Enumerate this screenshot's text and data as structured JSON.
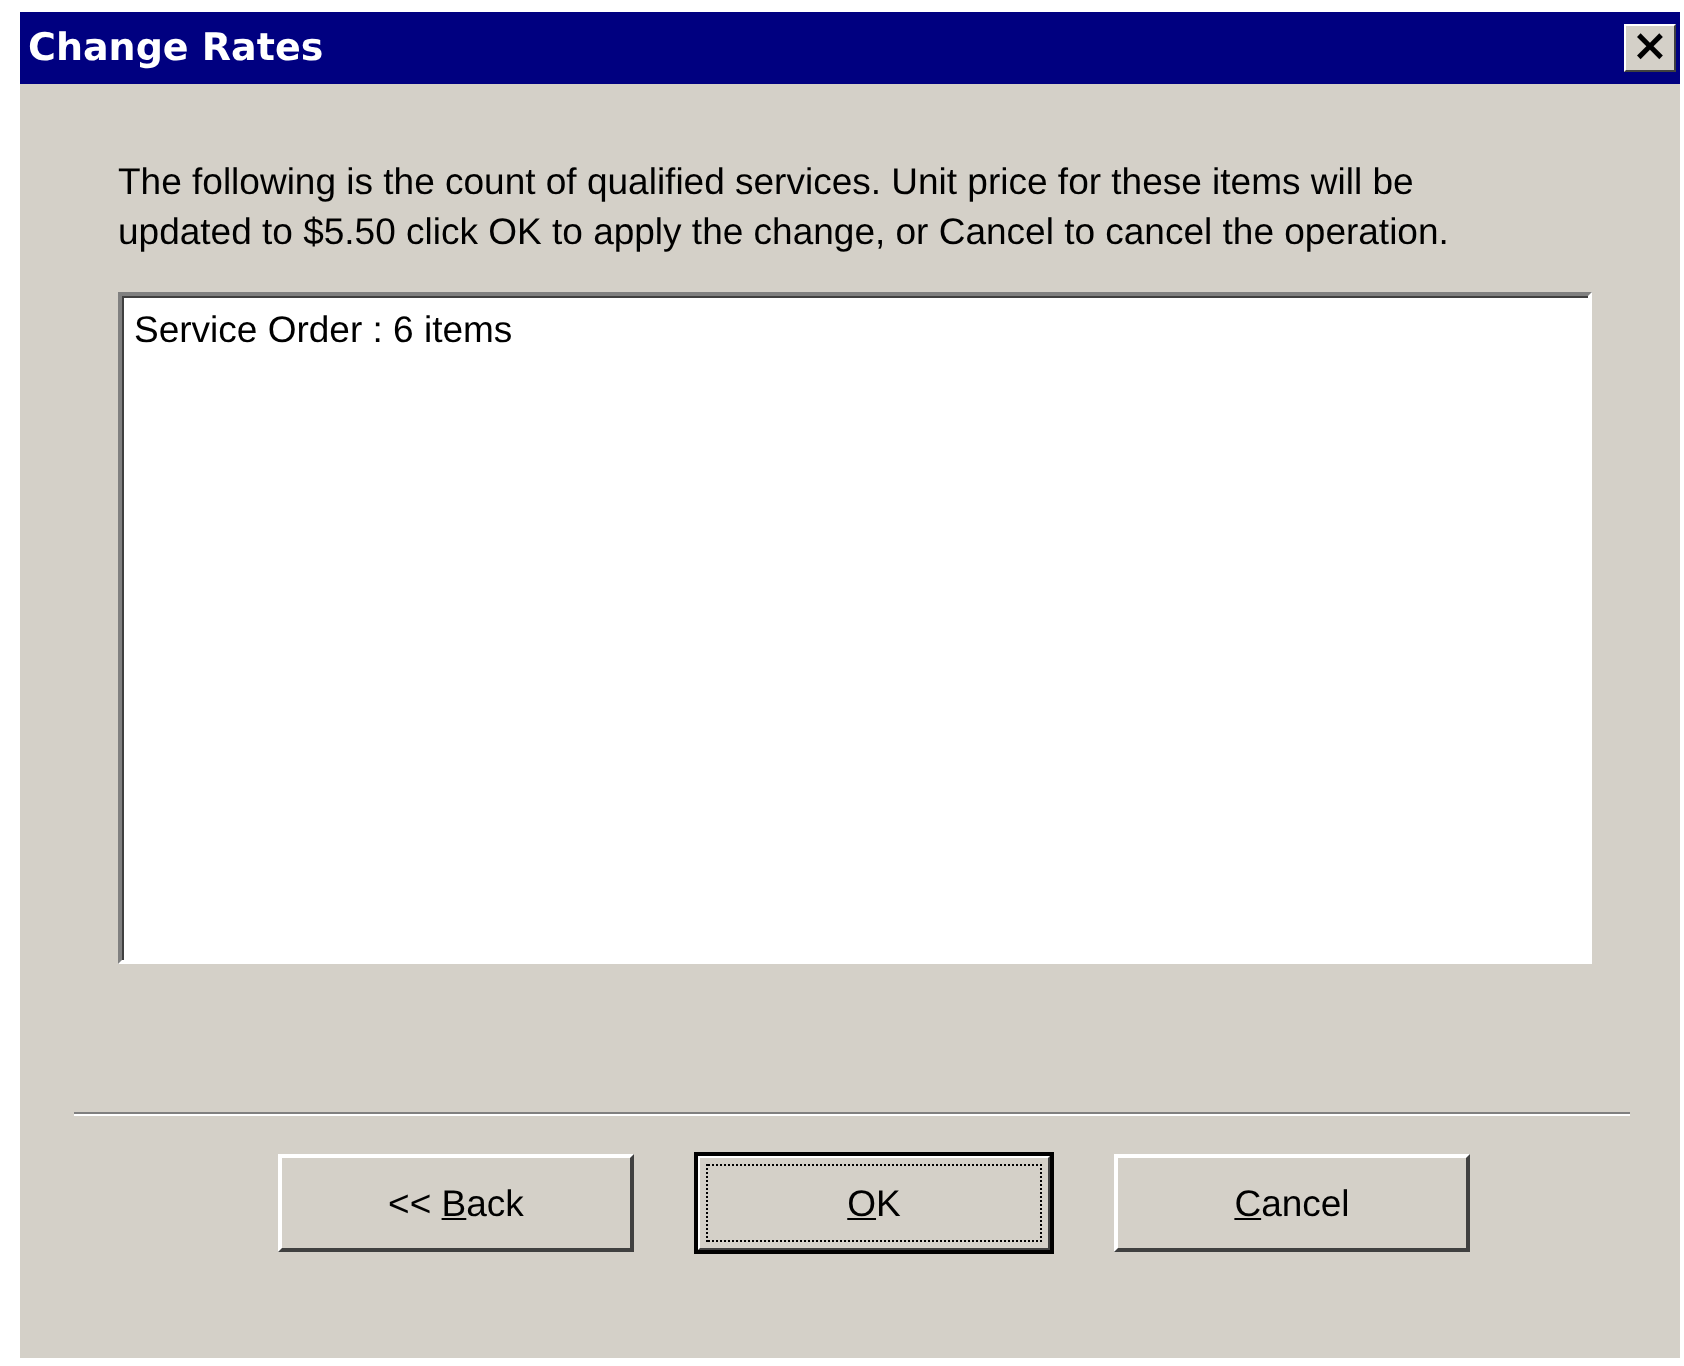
{
  "window": {
    "title": "Change Rates",
    "close": "×"
  },
  "message": "The following is the count of qualified services. Unit price for these items will be updated to $5.50 click OK to apply the change, or Cancel to cancel the operation.",
  "list": {
    "items": [
      "Service Order : 6 items"
    ]
  },
  "buttons": [
    {
      "before": "<< ",
      "key": "B",
      "after": "ack",
      "default": false
    },
    {
      "key": "O",
      "after": "K",
      "default": true
    },
    {
      "key": "C",
      "after": "ancel",
      "default": false
    }
  ]
}
